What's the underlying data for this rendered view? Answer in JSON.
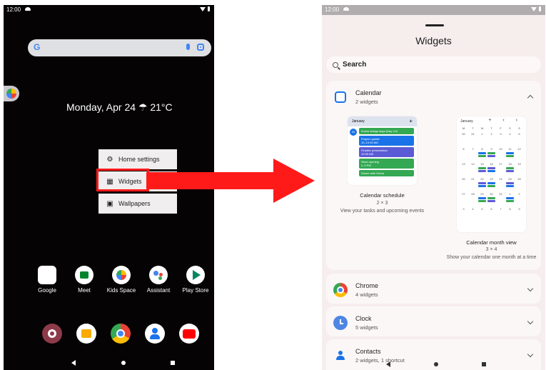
{
  "left_screen": {
    "status_bar": {
      "time": "12:00"
    },
    "date_weather": "Monday, Apr 24 ☂ 21°C",
    "context_menu": [
      {
        "label": "Home settings",
        "icon": "gear-icon"
      },
      {
        "label": "Widgets",
        "icon": "widgets-icon"
      },
      {
        "label": "Wallpapers",
        "icon": "wallpaper-icon"
      }
    ],
    "apps": [
      {
        "label": "Google"
      },
      {
        "label": "Meet"
      },
      {
        "label": "Kids Space"
      },
      {
        "label": "Assistant"
      },
      {
        "label": "Play Store"
      }
    ],
    "dock_apps": [
      "settings",
      "files",
      "chrome",
      "contacts",
      "youtube"
    ],
    "accent": "#ff1a1a"
  },
  "right_screen": {
    "status_bar": {
      "time": "12:00"
    },
    "title": "Widgets",
    "search_label": "Search",
    "calendar": {
      "title": "Calendar",
      "subtitle": "2 widgets",
      "schedule_widget": {
        "month": "January",
        "events": [
          "Zurich design days (Day 1/2)",
          "Project update",
          "10–10:30 AM",
          "Finalize presentation",
          "10:30 AM",
          "Store opening",
          "2–3 PM",
          "Dinner with Gloria"
        ],
        "name": "Calendar schedule",
        "dims": "2 × 3",
        "desc": "View your tasks and upcoming events"
      },
      "month_widget": {
        "month": "January",
        "controls": "+ ‹ ›",
        "dows": [
          "M",
          "T",
          "W",
          "T",
          "F",
          "S",
          "S"
        ],
        "days": [
          "30",
          "31",
          "1",
          "2",
          "3",
          "4",
          "5",
          "6",
          "7",
          "8",
          "9",
          "10",
          "11",
          "12",
          "13",
          "14",
          "15",
          "16",
          "17",
          "18",
          "19",
          "20",
          "21",
          "22",
          "23",
          "24",
          "25",
          "26",
          "27",
          "28",
          "29",
          "30",
          "31",
          "1",
          "2",
          "3",
          "4",
          "5",
          "6",
          "7",
          "8",
          "9"
        ],
        "name": "Calendar month view",
        "dims": "3 × 4",
        "desc": "Show your calendar one month at a time"
      }
    },
    "apps": [
      {
        "title": "Chrome",
        "subtitle": "4 widgets"
      },
      {
        "title": "Clock",
        "subtitle": "5 widgets"
      },
      {
        "title": "Contacts",
        "subtitle": "2 widgets, 1 shortcut"
      }
    ]
  }
}
